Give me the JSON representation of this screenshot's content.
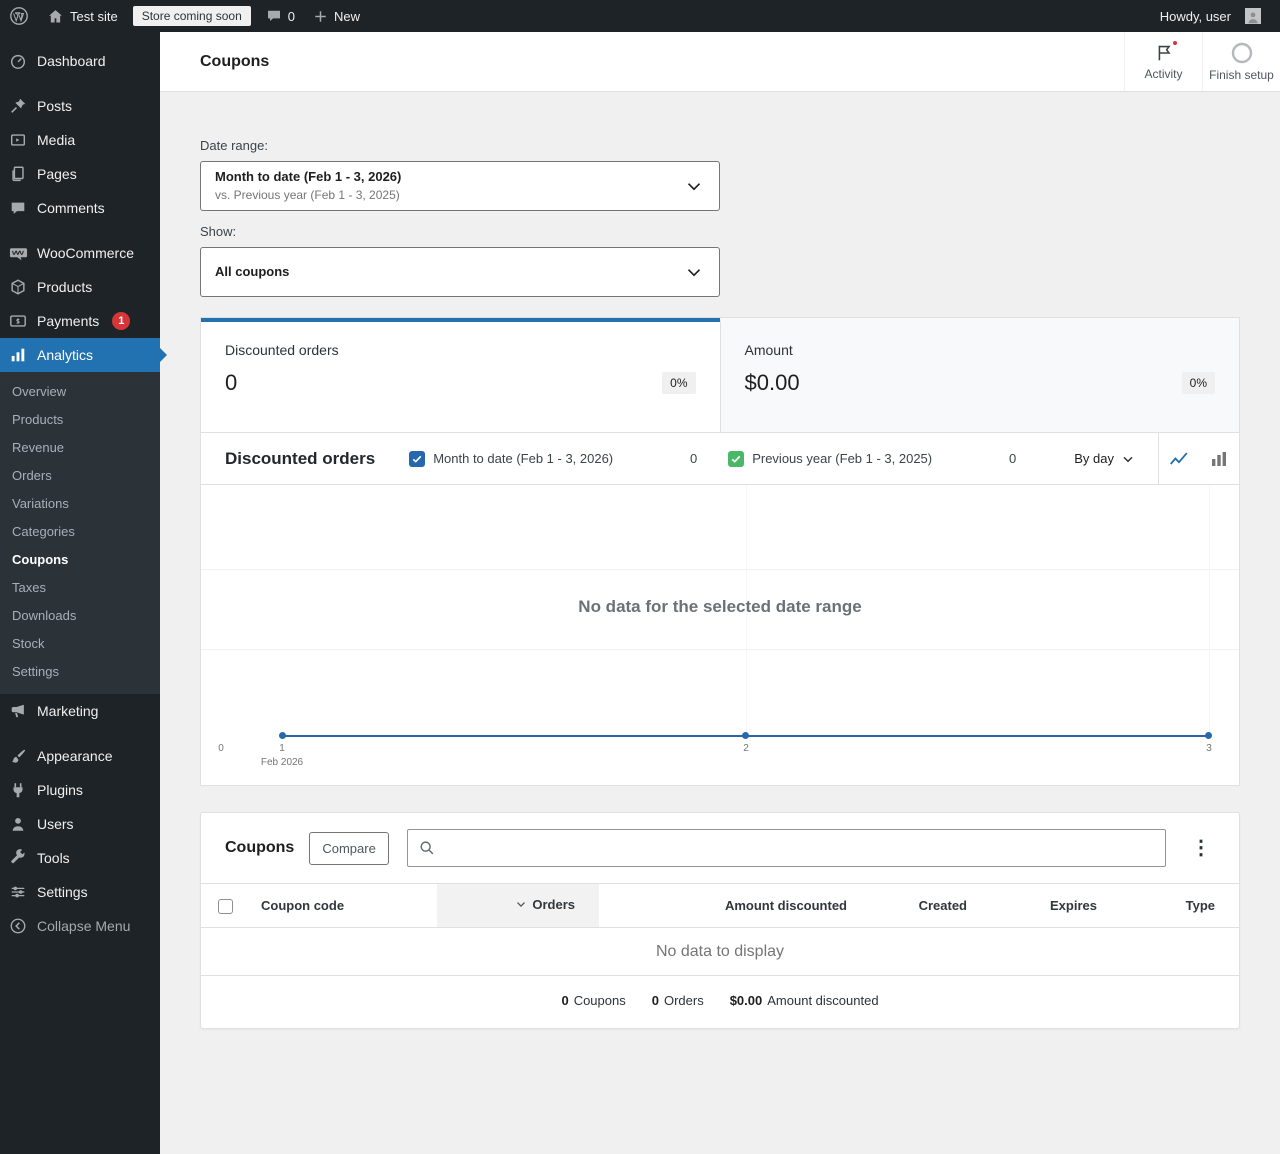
{
  "colors": {
    "accent": "#2271b1",
    "sidebar_bg": "#1d2327",
    "badge_red": "#d63638"
  },
  "admin_bar": {
    "site_name": "Test site",
    "coming_soon": "Store coming soon",
    "comments_count": "0",
    "new_label": "New",
    "howdy": "Howdy, user"
  },
  "sidebar": {
    "items": [
      {
        "label": "Dashboard"
      },
      {
        "label": "Posts"
      },
      {
        "label": "Media"
      },
      {
        "label": "Pages"
      },
      {
        "label": "Comments"
      },
      {
        "label": "WooCommerce"
      },
      {
        "label": "Products"
      },
      {
        "label": "Payments",
        "badge": "1"
      },
      {
        "label": "Analytics"
      },
      {
        "label": "Marketing"
      },
      {
        "label": "Appearance"
      },
      {
        "label": "Plugins"
      },
      {
        "label": "Users"
      },
      {
        "label": "Tools"
      },
      {
        "label": "Settings"
      },
      {
        "label": "Collapse Menu"
      }
    ],
    "submenu": [
      "Overview",
      "Products",
      "Revenue",
      "Orders",
      "Variations",
      "Categories",
      "Coupons",
      "Taxes",
      "Downloads",
      "Stock",
      "Settings"
    ]
  },
  "header": {
    "title": "Coupons",
    "activity_label": "Activity",
    "finish_setup_label": "Finish setup"
  },
  "filters": {
    "date_range_label": "Date range:",
    "date_range_value": "Month to date (Feb 1 - 3, 2026)",
    "date_range_compare": "vs. Previous year (Feb 1 - 3, 2025)",
    "show_label": "Show:",
    "show_value": "All coupons"
  },
  "summary": {
    "cards": [
      {
        "label": "Discounted orders",
        "value": "0",
        "delta": "0%"
      },
      {
        "label": "Amount",
        "value": "$0.00",
        "delta": "0%"
      }
    ]
  },
  "chart": {
    "title": "Discounted orders",
    "legend": [
      {
        "label": "Month to date (Feb 1 - 3, 2026)",
        "count": "0",
        "color": "#2767ae"
      },
      {
        "label": "Previous year (Feb 1 - 3, 2025)",
        "count": "0",
        "color": "#4ab866"
      }
    ],
    "interval": "By day",
    "empty_message": "No data for the selected date range",
    "line_color": "#2767ae",
    "x_ticks": [
      "0",
      "1",
      "2",
      "3"
    ],
    "x_sublabel": "Feb 2026"
  },
  "chart_data": {
    "type": "line",
    "title": "Discounted orders",
    "x": [
      "Feb 1",
      "Feb 2",
      "Feb 3"
    ],
    "series": [
      {
        "name": "Month to date (Feb 1 - 3, 2026)",
        "values": [
          0,
          0,
          0
        ]
      },
      {
        "name": "Previous year (Feb 1 - 3, 2025)",
        "values": [
          0,
          0,
          0
        ]
      }
    ],
    "ylim": [
      0,
      1
    ],
    "empty_message": "No data for the selected date range"
  },
  "table": {
    "title": "Coupons",
    "compare_label": "Compare",
    "search_value": "",
    "columns": [
      "Coupon code",
      "Orders",
      "Amount discounted",
      "Created",
      "Expires",
      "Type"
    ],
    "sorted_column": "Orders",
    "empty_message": "No data to display",
    "totals": [
      {
        "value": "0",
        "label": "Coupons"
      },
      {
        "value": "0",
        "label": "Orders"
      },
      {
        "value": "$0.00",
        "label": "Amount discounted"
      }
    ]
  }
}
